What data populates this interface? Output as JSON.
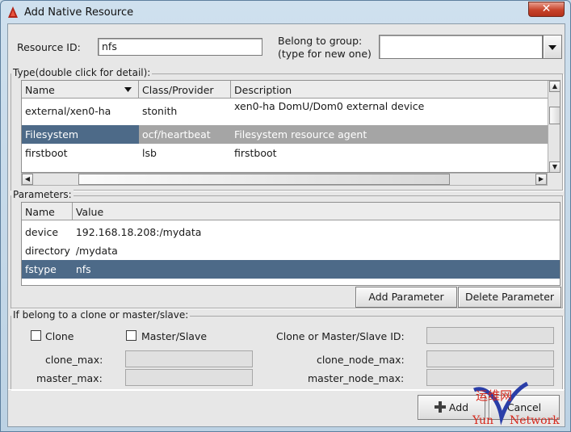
{
  "window": {
    "title": "Add Native Resource",
    "close": "✕"
  },
  "resource_id": {
    "label": "Resource ID:",
    "value": "nfs"
  },
  "group": {
    "label_line1": "Belong to group:",
    "label_line2": "(type for new one)",
    "value": ""
  },
  "type_table": {
    "group_label": "Type(double click for detail):",
    "columns": [
      "Name",
      "Class/Provider",
      "Description"
    ],
    "rows": [
      {
        "name": "external/xen0-ha",
        "class": "stonith",
        "desc": "xen0-ha DomU/Dom0 external device"
      },
      {
        "name": "Filesystem",
        "class": "ocf/heartbeat",
        "desc": "Filesystem resource agent"
      },
      {
        "name": "firstboot",
        "class": "lsb",
        "desc": "firstboot"
      }
    ]
  },
  "parameters": {
    "group_label": "Parameters:",
    "columns": [
      "Name",
      "Value"
    ],
    "rows": [
      {
        "name": "device",
        "value": "192.168.18.208:/mydata"
      },
      {
        "name": "directory",
        "value": "/mydata"
      },
      {
        "name": "fstype",
        "value": "nfs"
      }
    ],
    "add_button": "Add Parameter",
    "delete_button": "Delete Parameter"
  },
  "clone": {
    "group_label": "If belong to a clone or master/slave:",
    "clone_label": "Clone",
    "master_slave_label": "Master/Slave",
    "id_label": "Clone or Master/Slave ID:",
    "clone_max_label": "clone_max:",
    "master_max_label": "master_max:",
    "clone_node_max_label": "clone_node_max:",
    "master_node_max_label": "master_node_max:"
  },
  "footer": {
    "add_button": "Add",
    "cancel_button": "Cancel"
  },
  "watermark": {
    "line1": "运维网",
    "line2": "Yun",
    "line3": "Network"
  }
}
